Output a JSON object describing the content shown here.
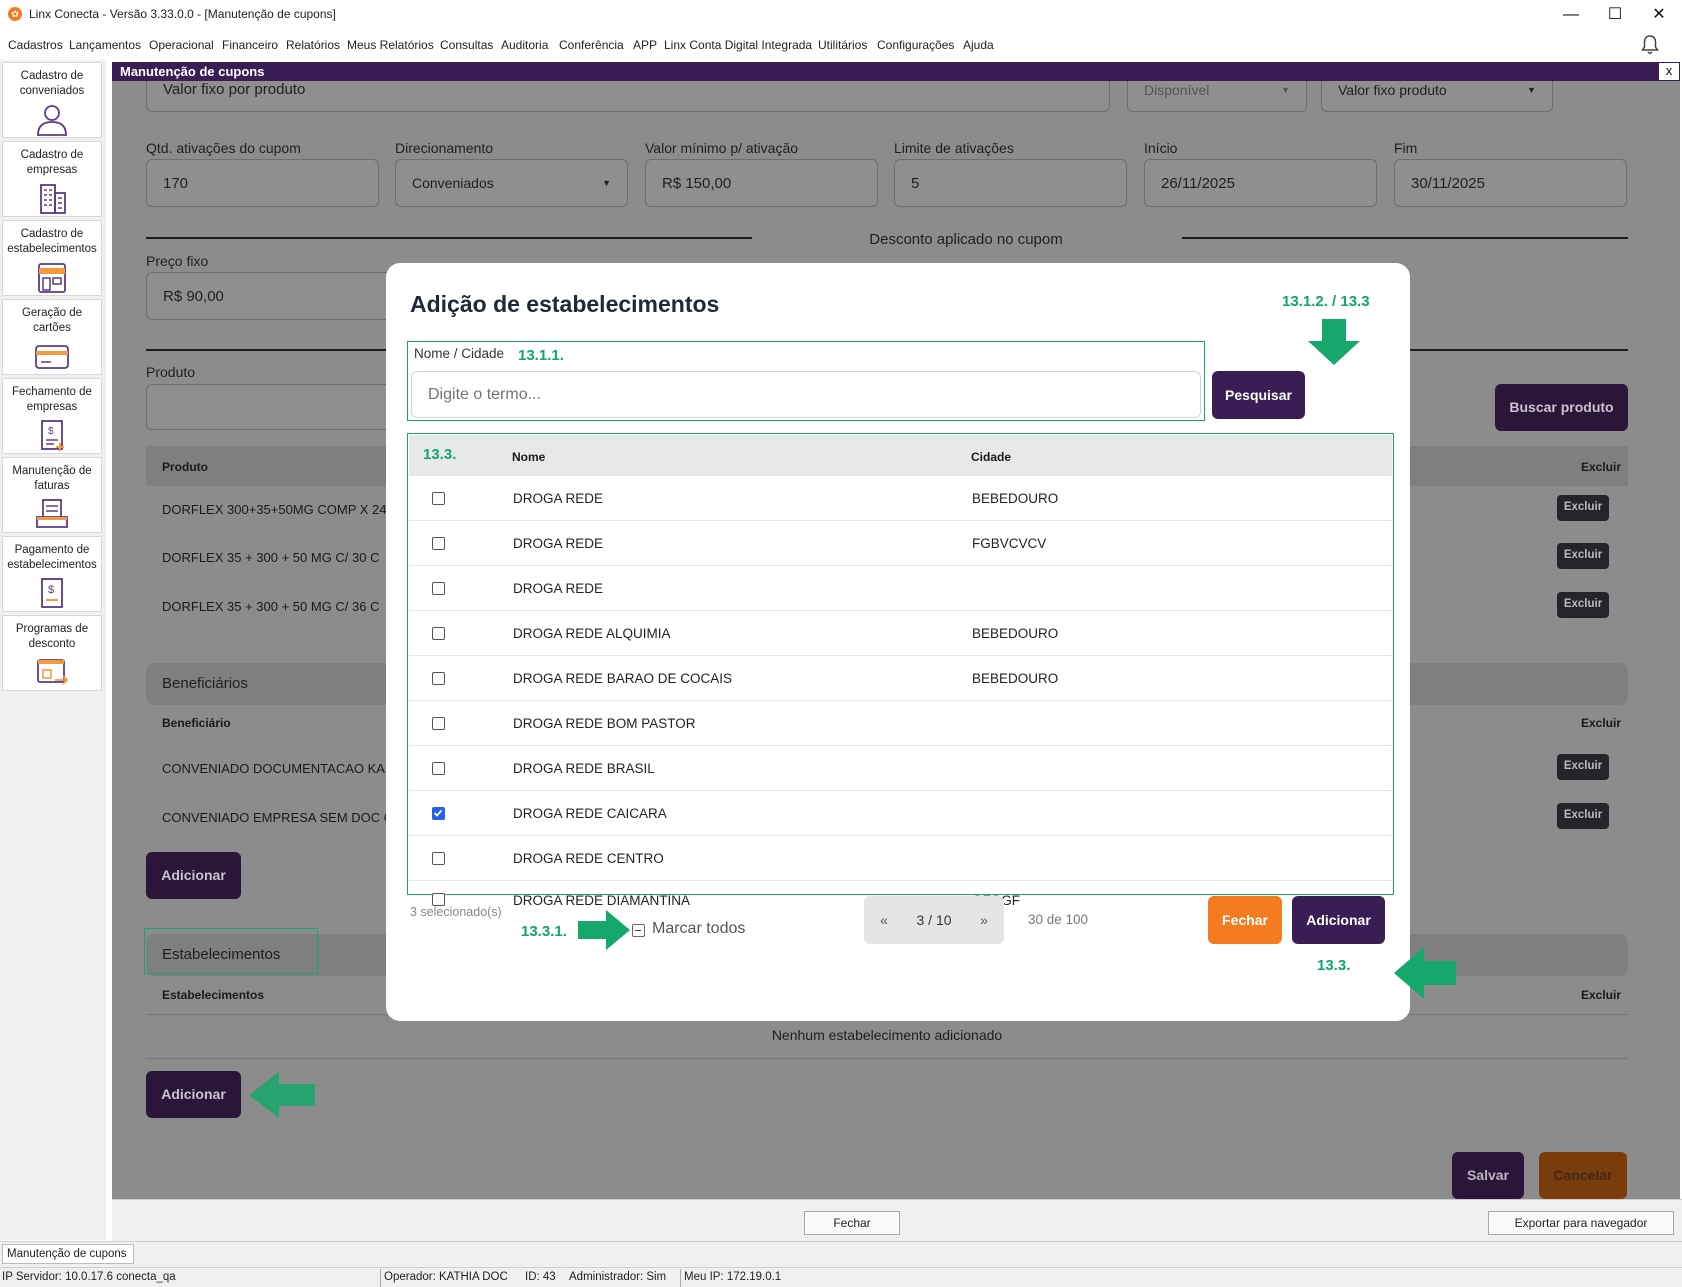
{
  "window": {
    "title": "Linx Conecta - Versão 3.33.0.0 - [Manutenção de cupons]"
  },
  "menu": [
    "Cadastros",
    "Lançamentos",
    "Operacional",
    "Financeiro",
    "Relatórios",
    "Meus Relatórios",
    "Consultas",
    "Auditoria",
    "Conferência",
    "APP",
    "Linx Conta Digital Integrada",
    "Utilitários",
    "Configurações",
    "Ajuda"
  ],
  "sidebar": [
    {
      "label": "Cadastro de conveniados",
      "icon": "person-icon"
    },
    {
      "label": "Cadastro de empresas",
      "icon": "building-icon"
    },
    {
      "label": "Cadastro de estabelecimentos",
      "icon": "store-icon"
    },
    {
      "label": "Geração de cartões",
      "icon": "card-icon"
    },
    {
      "label": "Fechamento de empresas",
      "icon": "invoice-close-icon"
    },
    {
      "label": "Manutenção de faturas",
      "icon": "invoice-tray-icon"
    },
    {
      "label": "Pagamento de estabelecimentos",
      "icon": "payment-doc-icon"
    },
    {
      "label": "Programas de desconto",
      "icon": "discount-program-icon"
    }
  ],
  "mdi": {
    "title": "Manutenção de cupons",
    "close": "x"
  },
  "form": {
    "top_value": "Valor fixo por produto",
    "status_select": "Disponível",
    "type_select": "Valor fixo produto",
    "qtd_label": "Qtd. ativações do cupom",
    "qtd_value": "170",
    "dir_label": "Direcionamento",
    "dir_value": "Conveniados",
    "min_label": "Valor mínimo p/ ativação",
    "min_value": "R$ 150,00",
    "limite_label": "Limite de ativações",
    "limite_value": "5",
    "inicio_label": "Início",
    "inicio_value": "26/11/2025",
    "fim_label": "Fim",
    "fim_value": "30/11/2025",
    "desconto_title": "Desconto aplicado no cupom",
    "preco_label": "Preço fixo",
    "preco_value": "R$ 90,00",
    "produto_label": "Produto",
    "buscar_produto": "Buscar produto"
  },
  "products": {
    "headers": {
      "produto": "Produto",
      "excluir": "Excluir"
    },
    "rows": [
      "DORFLEX 300+35+50MG COMP X 24",
      "DORFLEX 35 + 300 + 50 MG C/ 30 C",
      "DORFLEX 35 + 300 + 50 MG C/ 36 C"
    ],
    "delete_label": "Excluir"
  },
  "beneficiarios": {
    "title": "Beneficiários",
    "headers": {
      "beneficiario": "Beneficiário",
      "excluir": "Excluir"
    },
    "rows": [
      "CONVENIADO DOCUMENTACAO KA",
      "CONVENIADO EMPRESA SEM DOC C"
    ],
    "add": "Adicionar"
  },
  "estabelecimentos": {
    "title": "Estabelecimentos",
    "headers": {
      "estab": "Estabelecimentos",
      "excluir": "Excluir"
    },
    "empty": "Nenhum estabelecimento adicionado",
    "add": "Adicionar"
  },
  "footer_buttons": {
    "salvar": "Salvar",
    "cancelar": "Cancelar"
  },
  "modal": {
    "title": "Adição de estabelecimentos",
    "search_label": "Nome / Cidade",
    "search_placeholder": "Digite o termo...",
    "search_button": "Pesquisar",
    "col_nome": "Nome",
    "col_cidade": "Cidade",
    "rows": [
      {
        "nome": "DROGA REDE",
        "cidade": "BEBEDOURO",
        "checked": false
      },
      {
        "nome": "DROGA REDE",
        "cidade": "FGBVCVCV",
        "checked": false
      },
      {
        "nome": "DROGA REDE",
        "cidade": "",
        "checked": false
      },
      {
        "nome": "DROGA REDE ALQUIMIA",
        "cidade": "BEBEDOURO",
        "checked": false
      },
      {
        "nome": "DROGA REDE BARAO DE COCAIS",
        "cidade": "BEBEDOURO",
        "checked": false
      },
      {
        "nome": "DROGA REDE BOM PASTOR",
        "cidade": "",
        "checked": false
      },
      {
        "nome": "DROGA REDE BRASIL",
        "cidade": "",
        "checked": false
      },
      {
        "nome": "DROGA REDE CAICARA",
        "cidade": "",
        "checked": true
      },
      {
        "nome": "DROGA REDE CENTRO",
        "cidade": "",
        "checked": false
      },
      {
        "nome": "DROGA REDE DIAMANTINA",
        "cidade": "GFGGF",
        "checked": false
      }
    ],
    "selected_count": "3 selecionado(s)",
    "mark_all": "Marcar todos",
    "pager_prev": "«",
    "pager_page": "3 / 10",
    "pager_next": "»",
    "pager_total": "30 de 100",
    "close_button": "Fechar",
    "add_button": "Adicionar"
  },
  "annotations": {
    "search_field": "13.1.1.",
    "search_button": "13.1.2. / 13.3",
    "table": "13.3.",
    "mark_all": "13.3.1.",
    "add_button": "13.3.",
    "color": "#0ea86a"
  },
  "bottom": {
    "fechar": "Fechar",
    "exportar": "Exportar para navegador"
  },
  "taskbar": {
    "tab": "Manutenção de cupons"
  },
  "status": {
    "servidor": "IP Servidor: 10.0.17.6 conecta_qa",
    "operador": "Operador: KATHIA DOC",
    "id": "ID: 43",
    "admin": "Administrador: Sim",
    "meuip": "Meu IP: 172.19.0.1"
  }
}
